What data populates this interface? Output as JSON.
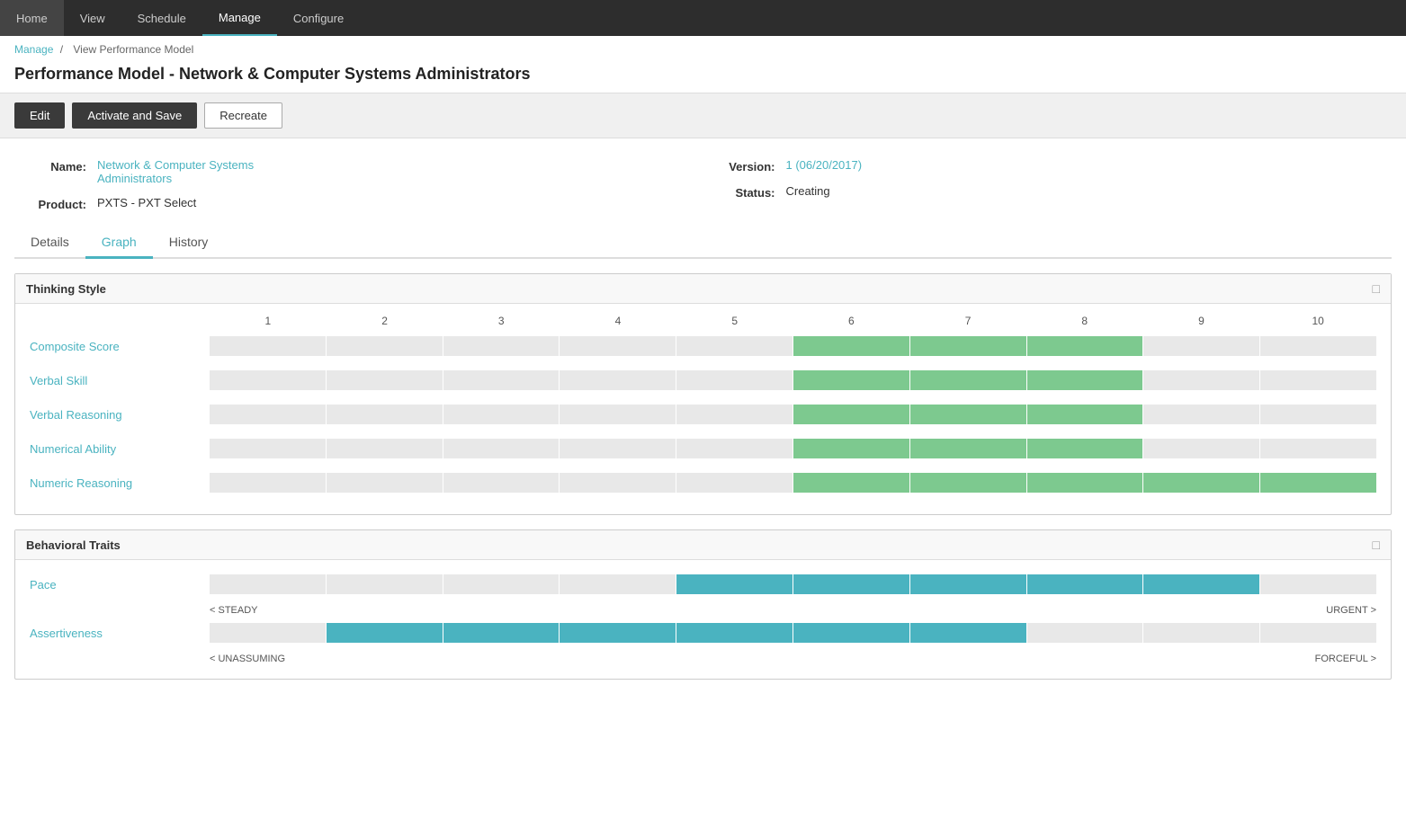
{
  "nav": {
    "items": [
      {
        "label": "Home",
        "active": false
      },
      {
        "label": "View",
        "active": false
      },
      {
        "label": "Schedule",
        "active": false
      },
      {
        "label": "Manage",
        "active": true
      },
      {
        "label": "Configure",
        "active": false
      }
    ]
  },
  "breadcrumb": {
    "parts": [
      "Manage",
      "View Performance Model"
    ]
  },
  "page": {
    "title": "Performance Model - Network & Computer Systems Administrators"
  },
  "toolbar": {
    "edit_label": "Edit",
    "activate_save_label": "Activate and Save",
    "recreate_label": "Recreate"
  },
  "info": {
    "name_label": "Name:",
    "name_value": "Network & Computer Systems Administrators",
    "version_label": "Version:",
    "version_value": "1 (06/20/2017)",
    "product_label": "Product:",
    "product_value": "PXTS - PXT Select",
    "status_label": "Status:",
    "status_value": "Creating"
  },
  "tabs": [
    {
      "label": "Details",
      "active": false
    },
    {
      "label": "Graph",
      "active": true
    },
    {
      "label": "History",
      "active": false
    }
  ],
  "thinking_style": {
    "title": "Thinking Style",
    "scale": [
      "1",
      "2",
      "3",
      "4",
      "5",
      "6",
      "7",
      "8",
      "9",
      "10"
    ],
    "rows": [
      {
        "label": "Composite Score",
        "segments": [
          0,
          0,
          0,
          0,
          0,
          1,
          1,
          1,
          0,
          0
        ]
      },
      {
        "label": "Verbal Skill",
        "segments": [
          0,
          0,
          0,
          0,
          0,
          1,
          1,
          1,
          0,
          0
        ]
      },
      {
        "label": "Verbal Reasoning",
        "segments": [
          0,
          0,
          0,
          0,
          0,
          1,
          1,
          1,
          0,
          0
        ]
      },
      {
        "label": "Numerical Ability",
        "segments": [
          0,
          0,
          0,
          0,
          0,
          1,
          1,
          1,
          0,
          0
        ]
      },
      {
        "label": "Numeric Reasoning",
        "segments": [
          0,
          0,
          0,
          0,
          0,
          1,
          1,
          1,
          1,
          1
        ]
      }
    ]
  },
  "behavioral_traits": {
    "title": "Behavioral Traits",
    "rows": [
      {
        "label": "Pace",
        "segments": [
          0,
          0,
          0,
          0,
          1,
          1,
          1,
          1,
          1,
          0
        ],
        "left_label": "< STEADY",
        "right_label": "URGENT >"
      },
      {
        "label": "Assertiveness",
        "segments": [
          0,
          1,
          1,
          1,
          1,
          1,
          1,
          0,
          0,
          0
        ],
        "left_label": "< UNASSUMING",
        "right_label": "FORCEFUL >"
      }
    ]
  }
}
